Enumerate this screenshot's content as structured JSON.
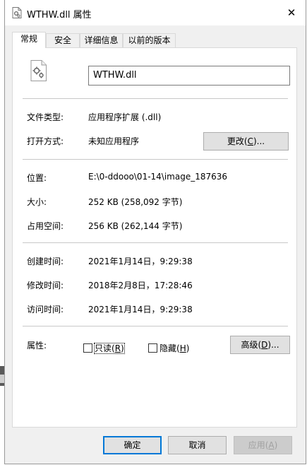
{
  "window": {
    "title": "WTHW.dll 属性",
    "close_label": "✕"
  },
  "tabs": [
    {
      "label": "常规",
      "active": true
    },
    {
      "label": "安全",
      "active": false
    },
    {
      "label": "详细信息",
      "active": false
    },
    {
      "label": "以前的版本",
      "active": false
    }
  ],
  "general": {
    "file_name": "WTHW.dll",
    "file_type_label": "文件类型:",
    "file_type_value": "应用程序扩展 (.dll)",
    "open_with_label": "打开方式:",
    "open_with_value": "未知应用程序",
    "change_button": {
      "prefix": "更改(",
      "hotkey": "C",
      "suffix": ")..."
    },
    "location_label": "位置:",
    "location_value": "E:\\0-ddooo\\01-14\\image_187636",
    "size_label": "大小:",
    "size_value": "252 KB (258,092 字节)",
    "disk_size_label": "占用空间:",
    "disk_size_value": "256 KB (262,144 字节)",
    "created_label": "创建时间:",
    "created_value": "2021年1月14日，9:29:38",
    "modified_label": "修改时间:",
    "modified_value": "2018年2月8日，17:28:46",
    "accessed_label": "访问时间:",
    "accessed_value": "2021年1月14日，9:29:38",
    "attributes_label": "属性:",
    "readonly": {
      "prefix": "只读(",
      "hotkey": "R",
      "suffix": ")",
      "checked": false
    },
    "hidden": {
      "prefix": "隐藏(",
      "hotkey": "H",
      "suffix": ")",
      "checked": false
    },
    "advanced_button": {
      "prefix": "高级(",
      "hotkey": "D",
      "suffix": ")..."
    }
  },
  "footer": {
    "ok_label": "确定",
    "cancel_label": "取消",
    "apply": {
      "prefix": "应用(",
      "hotkey": "A",
      "suffix": ")"
    }
  },
  "icons": {
    "title": "file-gear-icon",
    "file": "dll-file-icon",
    "close": "close-icon"
  },
  "colors": {
    "focus_border": "#0078d7",
    "disabled_text": "#a0a0a0"
  }
}
